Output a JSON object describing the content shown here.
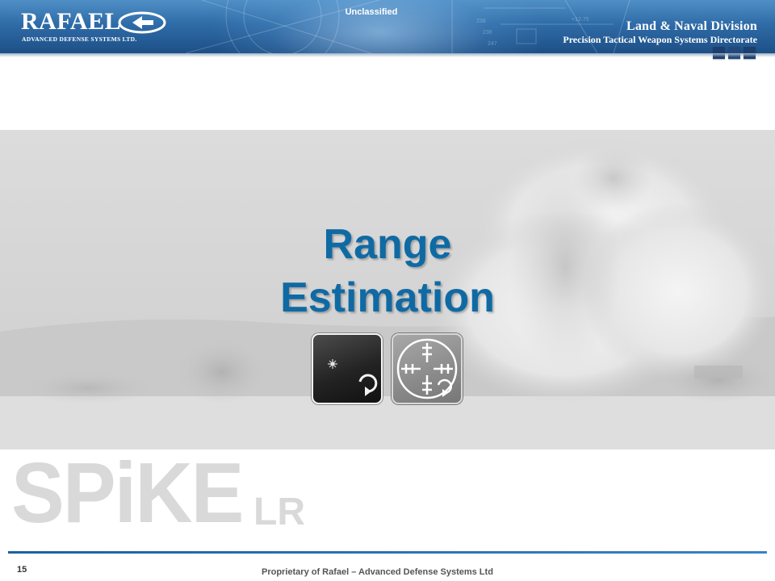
{
  "header": {
    "logo": {
      "name": "RAFAEL",
      "tagline": "ADVANCED DEFENSE SYSTEMS LTD."
    },
    "classification": "Unclassified",
    "division": {
      "title": "Land & Naval Division",
      "subtitle": "Precision Tactical Weapon Systems Directorate"
    }
  },
  "slide": {
    "title_line1": "Range",
    "title_line2": "Estimation",
    "icons": [
      "laser-range-icon",
      "crosshair-grid-icon"
    ]
  },
  "brand": {
    "product": "SPiKE",
    "variant": "LR"
  },
  "footer": {
    "page_number": "15",
    "text": "Proprietary of Rafael – Advanced Defense Systems Ltd"
  },
  "colors": {
    "title": "#0f6aa4",
    "banner": "#2f6ca8",
    "footer_rule": "#1e5fa3",
    "brand_gray": "#d9d9d9"
  }
}
